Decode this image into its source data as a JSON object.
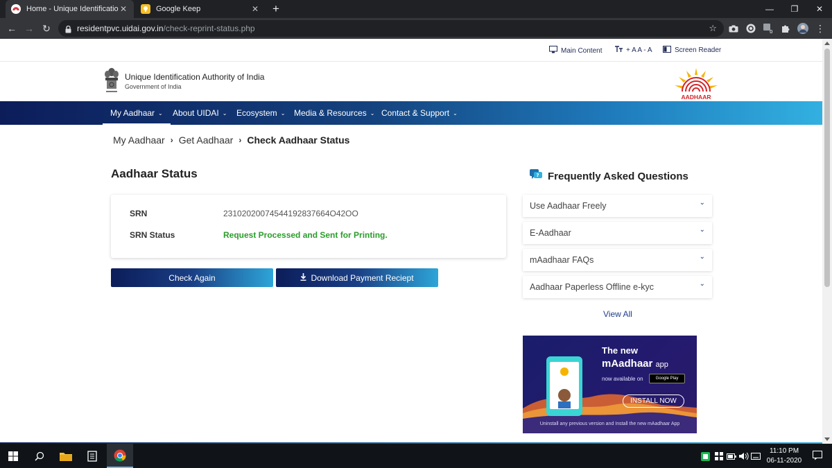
{
  "browser": {
    "tabs": [
      {
        "title": "Home - Unique Identification Au",
        "active": true
      },
      {
        "title": "Google Keep",
        "active": false
      }
    ],
    "url_host": "residentpvc.uidai.gov.in",
    "url_path": "/check-reprint-status.php"
  },
  "accessibility_bar": {
    "main_content": "Main Content",
    "text_size": "+ A A - A",
    "screen_reader": "Screen Reader"
  },
  "header": {
    "org_name": "Unique Identification Authority of India",
    "org_sub": "Government of India",
    "logo_text": "AADHAAR"
  },
  "nav": {
    "items": [
      {
        "label": "My Aadhaar"
      },
      {
        "label": "About UIDAI"
      },
      {
        "label": "Ecosystem"
      },
      {
        "label": "Media & Resources"
      },
      {
        "label": "Contact & Support"
      }
    ]
  },
  "breadcrumb": [
    "My Aadhaar",
    "Get Aadhaar",
    "Check Aadhaar Status"
  ],
  "status": {
    "title": "Aadhaar Status",
    "srn_label": "SRN",
    "srn_value": "23102020074544192837664O42OO",
    "srn_status_label": "SRN Status",
    "srn_status_value": "Request Processed and Sent for Printing.",
    "check_again": "Check Again",
    "download_receipt": "Download Payment Reciept"
  },
  "faq": {
    "heading": "Frequently Asked Questions",
    "items": [
      {
        "q": "Use Aadhaar Freely"
      },
      {
        "q": "E-Aadhaar"
      },
      {
        "q": "mAadhaar FAQs"
      },
      {
        "q": "Aadhaar Paperless Offline e-kyc"
      }
    ],
    "view_all": "View All"
  },
  "promo": {
    "line1": "The new",
    "line2": "mAadhaar",
    "line2_suffix": "app",
    "available": "now available on",
    "store": "Google Play",
    "install": "INSTALL NOW",
    "note": "Uninstall any previous version and Install the new mAadhaar App"
  },
  "taskbar": {
    "time": "11:10 PM",
    "date": "06-11-2020"
  },
  "colors": {
    "nav_gradient_start": "#0c1d5a",
    "nav_gradient_end": "#32b0e0",
    "success_green": "#2a9d2a",
    "brand_red": "#d6232a",
    "brand_yellow": "#f5b400"
  }
}
